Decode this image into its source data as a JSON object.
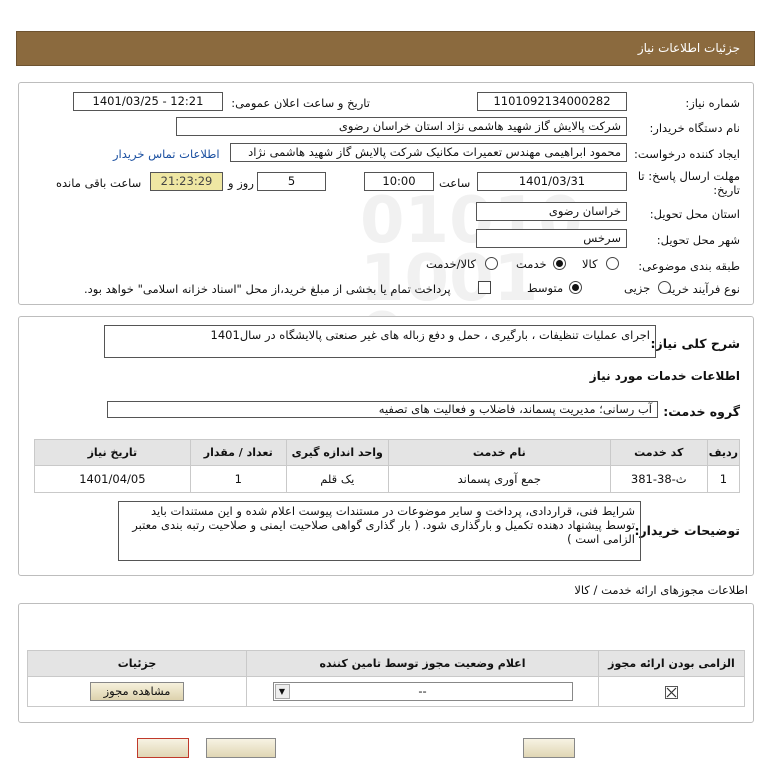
{
  "page": {
    "title": "جزئیات اطلاعات نیاز"
  },
  "form": {
    "need_number_label": "شماره نیاز:",
    "need_number": "1101092134000282",
    "announce_label": "تاریخ و ساعت اعلان عمومی:",
    "announce_value": "1401/03/25 - 12:21",
    "buyer_org_label": "نام دستگاه خریدار:",
    "buyer_org": "شرکت پالایش گاز شهید هاشمی نژاد   استان خراسان رضوی",
    "creator_label": "ایجاد کننده درخواست:",
    "creator": "محمود ابراهیمی مهندس تعمیرات مکانیک شرکت پالایش گاز شهید هاشمی نژاد",
    "contact_link": "اطلاعات تماس خریدار",
    "deadline_label_1": "مهلت ارسال پاسخ: تا",
    "deadline_label_2": "تاریخ:",
    "deadline_date": "1401/03/31",
    "time_label": "ساعت",
    "deadline_time": "10:00",
    "days_value": "5",
    "days_label": "روز و",
    "remaining_time": "21:23:29",
    "remaining_label": "ساعت باقی مانده",
    "province_label": "استان محل تحویل:",
    "province": "خراسان رضوی",
    "city_label": "شهر محل تحویل:",
    "city": "سرخس",
    "category_label": "طبقه بندی موضوعی:",
    "category_options": [
      "کالا",
      "خدمت",
      "کالا/خدمت"
    ],
    "category_selected": "خدمت",
    "process_label": "نوع فرآیند خرید :",
    "process_options": [
      "جزیی",
      "متوسط"
    ],
    "process_selected": "متوسط",
    "treasury_text": "پرداخت تمام یا بخشی از مبلغ خرید،از محل \"اسناد خزانه اسلامی\" خواهد بود."
  },
  "summary": {
    "label": "شرح کلی نیاز:",
    "text": "اجرای عملیات تنظیفات ، بارگیری ، حمل و دفع زباله های غیر صنعتی پالایشگاه در سال1401"
  },
  "services": {
    "section_title": "اطلاعات خدمات مورد نیاز",
    "group_label": "گروه خدمت:",
    "group_value": "آب رسانی؛ مدیریت پسماند، فاضلاب و فعالیت های تصفیه",
    "columns": [
      "ردیف",
      "کد خدمت",
      "نام خدمت",
      "واحد اندازه گیری",
      "تعداد / مقدار",
      "تاریخ نیاز"
    ],
    "rows": [
      [
        "1",
        "ث-38-381",
        "جمع آوری پسماند",
        "یک قلم",
        "1",
        "1401/04/05"
      ]
    ]
  },
  "buyer_notes": {
    "label": "توضیحات خریدار:",
    "text": "شرایط فنی، قراردادی، پرداخت و سایر موضوعات در مستندات پیوست اعلام شده و این مستندات باید توسط پیشنهاد دهنده تکمیل و  بارگذاری شود. ( بار گذاری گواهی صلاحیت ایمنی و صلاحیت رتبه بندی معتبر الزامی است )"
  },
  "permits": {
    "section_title": "اطلاعات مجوزهای ارائه خدمت / کالا",
    "columns": [
      "الزامی بودن ارائه مجوز",
      "اعلام وضعیت مجوز توسط تامین کننده",
      "جزئیات"
    ],
    "status_value": "--",
    "view_button": "مشاهده مجوز"
  },
  "watermark": {
    "line1": "ParsNamadData",
    "line2": "مرکز فراخوان استعلامات و مناقصات",
    "line3": "پایگاه اطلاع رسانی مناقصه ومزایده"
  },
  "colors": {
    "header": "#8b6a3e",
    "remaining_bg": "#efe7a3",
    "link": "#1a4fa0"
  }
}
